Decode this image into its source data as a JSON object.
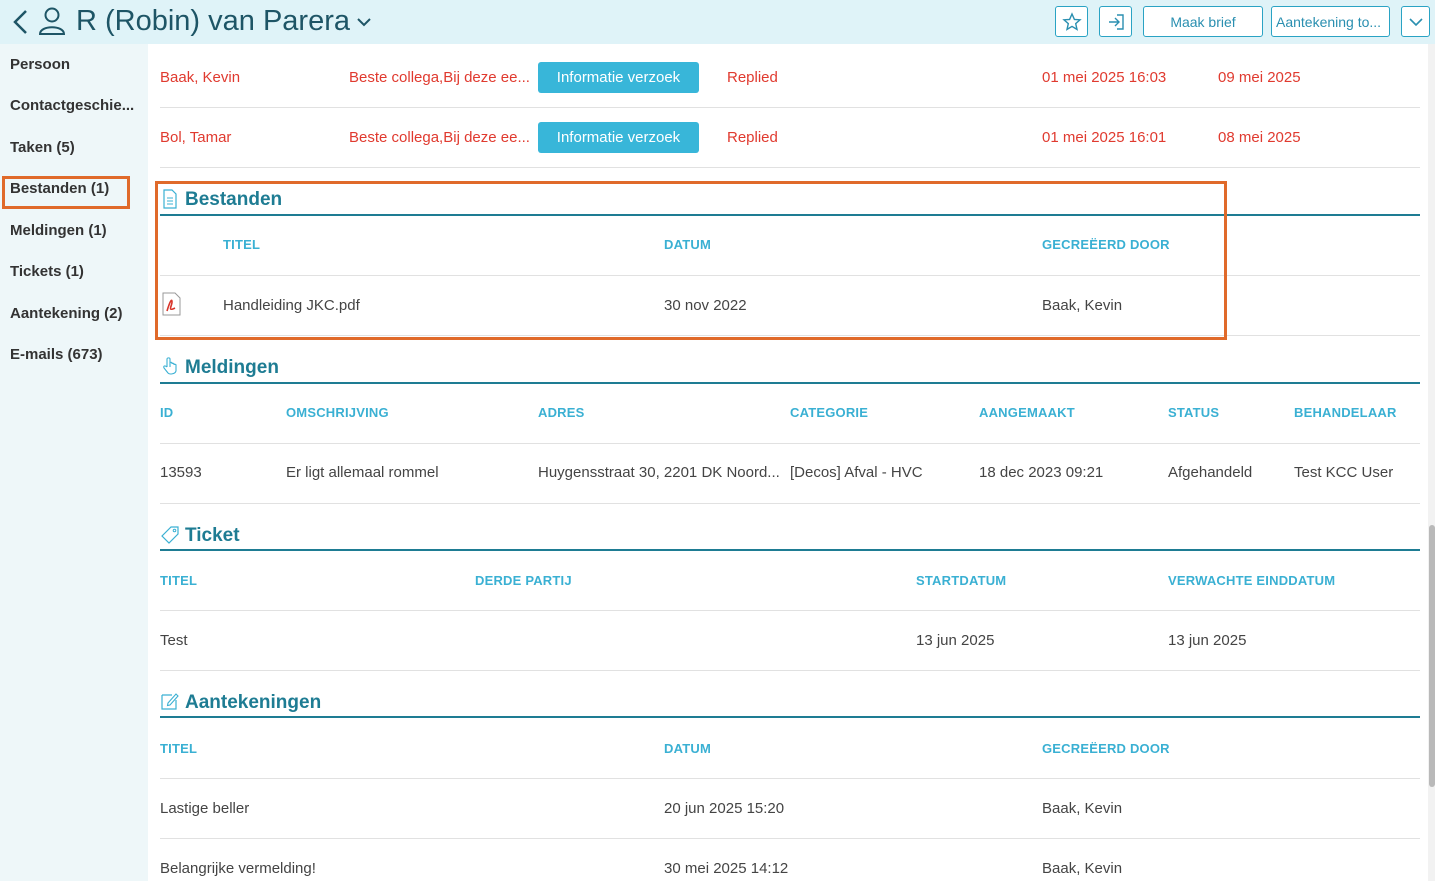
{
  "header": {
    "title": "R (Robin) van Parera",
    "buttons": {
      "maak_brief": "Maak brief",
      "aantekening": "Aantekening to..."
    }
  },
  "sidebar": {
    "items": [
      {
        "label": "Persoon"
      },
      {
        "label": "Contactgeschie..."
      },
      {
        "label": "Taken (5)"
      },
      {
        "label": "Bestanden (1)"
      },
      {
        "label": "Meldingen (1)"
      },
      {
        "label": "Tickets (1)"
      },
      {
        "label": "Aantekening (2)"
      },
      {
        "label": "E-mails (673)"
      }
    ]
  },
  "tasks": {
    "rows": [
      {
        "name": "Baak, Kevin",
        "message": "Beste collega,Bij deze ee...",
        "type": "Informatie verzoek",
        "status": "Replied",
        "created": "01 mei 2025 16:03",
        "due": "09 mei 2025"
      },
      {
        "name": "Bol, Tamar",
        "message": "Beste collega,Bij deze ee...",
        "type": "Informatie verzoek",
        "status": "Replied",
        "created": "01 mei 2025 16:01",
        "due": "08 mei 2025"
      }
    ]
  },
  "bestanden": {
    "title": "Bestanden",
    "headers": {
      "titel": "TITEL",
      "datum": "DATUM",
      "gecreeerd": "GECREËERD DOOR"
    },
    "rows": [
      {
        "titel": "Handleiding JKC.pdf",
        "datum": "30 nov 2022",
        "door": "Baak, Kevin"
      }
    ]
  },
  "meldingen": {
    "title": "Meldingen",
    "headers": {
      "id": "ID",
      "omschrijving": "OMSCHRIJVING",
      "adres": "ADRES",
      "categorie": "CATEGORIE",
      "aangemaakt": "AANGEMAAKT",
      "status": "STATUS",
      "behandelaar": "BEHANDELAAR"
    },
    "rows": [
      {
        "id": "13593",
        "omschrijving": "Er ligt allemaal rommel",
        "adres": "Huygensstraat 30, 2201 DK Noord...",
        "categorie": "[Decos] Afval - HVC",
        "aangemaakt": "18 dec 2023 09:21",
        "status": "Afgehandeld",
        "behandelaar": "Test KCC User"
      }
    ]
  },
  "ticket": {
    "title": "Ticket",
    "headers": {
      "titel": "TITEL",
      "derde": "DERDE PARTIJ",
      "start": "STARTDATUM",
      "eind": "VERWACHTE EINDDATUM"
    },
    "rows": [
      {
        "titel": "Test",
        "derde": "",
        "start": "13 jun 2025",
        "eind": "13 jun 2025"
      }
    ]
  },
  "aantekeningen": {
    "title": "Aantekeningen",
    "headers": {
      "titel": "TITEL",
      "datum": "DATUM",
      "gecreeerd": "GECREËERD DOOR"
    },
    "rows": [
      {
        "titel": "Lastige beller",
        "datum": "20 jun 2025 15:20",
        "door": "Baak, Kevin"
      },
      {
        "titel": "Belangrijke vermelding!",
        "datum": "30 mei 2025 14:12",
        "door": "Baak, Kevin"
      }
    ]
  },
  "colors": {
    "accent": "#1e7c93",
    "header_cell": "#3ab0d3",
    "alert": "#e03a2f",
    "highlight": "#e06a2a"
  }
}
